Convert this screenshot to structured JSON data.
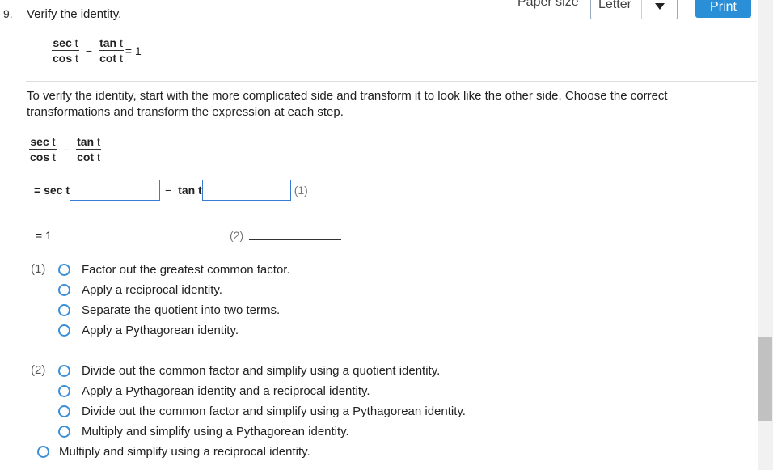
{
  "question": {
    "number": "9.",
    "title": "Verify the identity."
  },
  "toolbar": {
    "paper_size_label": "Paper size",
    "paper_size_value": "Letter",
    "print_label": "Print"
  },
  "identity": {
    "sec_word": "sec",
    "tan_word": "tan",
    "var": "t",
    "cos_word": "cos",
    "cot_word": "cot",
    "minus": "−",
    "rhs": "= 1"
  },
  "instructions": "To verify the identity, start with the more complicated side and transform it to look like the other side. Choose the correct transformations and transform the expression at each step.",
  "work": {
    "step1_prefix": "= sec t",
    "step1_input1_value": "",
    "step1_minus": "−",
    "step1_tan": "tan t",
    "step1_input2_value": "",
    "step1_number": "(1)",
    "step2_eq": "= 1",
    "step2_number": "(2)"
  },
  "choices_1": {
    "label": "(1)",
    "options": [
      "Factor out the greatest common factor.",
      "Apply a reciprocal identity.",
      "Separate the quotient into two terms.",
      "Apply a Pythagorean identity."
    ]
  },
  "choices_2": {
    "label": "(2)",
    "options": [
      "Divide out the common factor and simplify using a quotient identity.",
      "Apply a Pythagorean identity and a reciprocal identity.",
      "Divide out the common factor and simplify using a Pythagorean identity.",
      "Multiply and simplify using a Pythagorean identity.",
      "Multiply and simplify using a reciprocal identity."
    ]
  },
  "colors": {
    "accent": "#2a8fd7",
    "radio_border": "#3a8fd9",
    "input_border": "#3a7bd5"
  }
}
